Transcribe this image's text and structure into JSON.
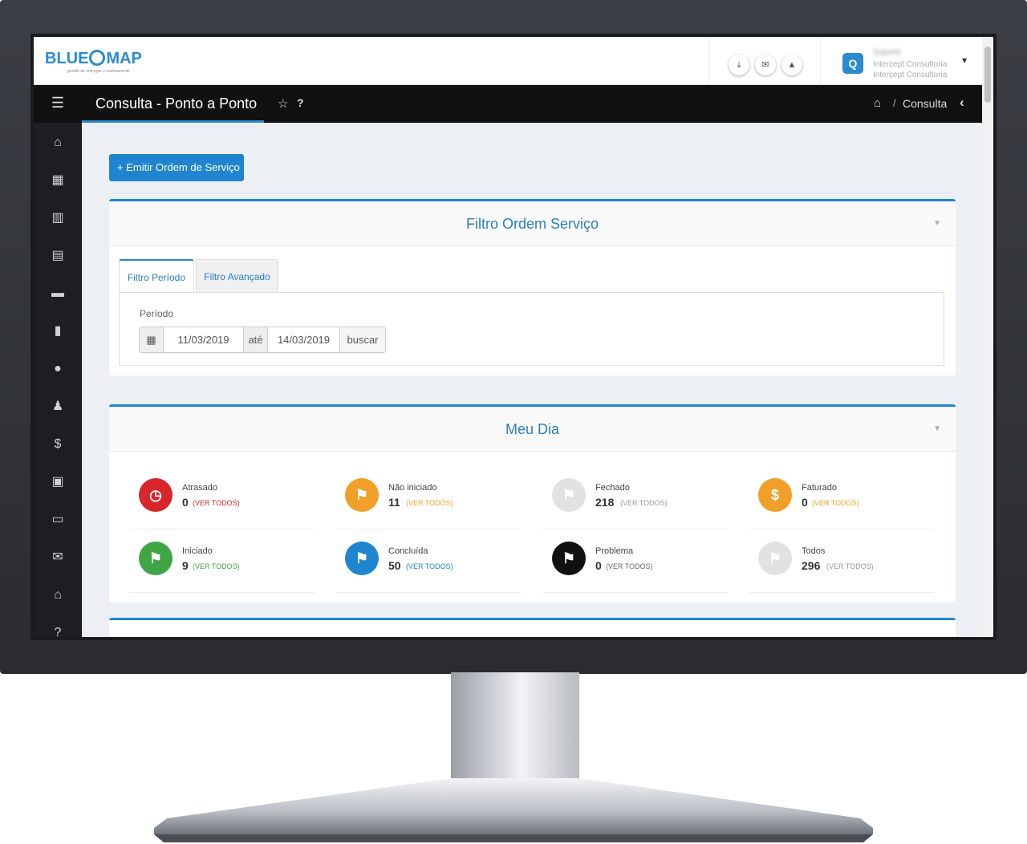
{
  "app": {
    "logo_left": "BLUE",
    "logo_right": "MAP",
    "logo_tagline": "gestão de entregas e rastreamento"
  },
  "topbar": {
    "icons": [
      "download-icon",
      "envelope-icon",
      "bell-icon"
    ],
    "user": {
      "name": "Suporte",
      "org_line1": "Intercept Consultoria",
      "org_line2": "Intercept Consultoria",
      "chevron": "⌄"
    }
  },
  "titlebar": {
    "menu_icon": "☰",
    "title": "Consulta - Ponto a Ponto",
    "star_icon": "☆",
    "help_icon": "?",
    "breadcrumb_sep": "/",
    "breadcrumb_label": "Consulta",
    "back_icon": "‹"
  },
  "sidebar": {
    "items": [
      "home-icon",
      "calendar-icon",
      "bar-chart-icon",
      "document-icon",
      "truck-icon",
      "file-icon",
      "map-marker-icon",
      "person-icon",
      "dollar-icon",
      "money-icon",
      "credit-card-icon",
      "envelope-icon",
      "bank-icon",
      "question-icon"
    ]
  },
  "main": {
    "emit_button": "+ Emitir Ordem de Serviço",
    "filter_panel": {
      "title": "Filtro Ordem Serviço",
      "tabs": [
        "Filtro Período",
        "Filtro Avançado"
      ],
      "periodo_label": "Período",
      "date_start": "11/03/2019",
      "date_sep": "até",
      "date_end": "14/03/2019",
      "search_button": "buscar"
    },
    "meu_dia_panel": {
      "title": "Meu Dia",
      "stats": [
        {
          "label": "Atrasado",
          "count": "0",
          "link": "(VER TODOS)",
          "color": "#d9262b",
          "link_color": "#d9262b"
        },
        {
          "label": "Não iniciado",
          "count": "11",
          "link": "(VER TODOS)",
          "color": "#f0a028",
          "link_color": "#f0a028"
        },
        {
          "label": "Fechado",
          "count": "218",
          "link": "(VER TODOS)",
          "color": "#e2e2e2",
          "link_color": "#999999"
        },
        {
          "label": "Faturado",
          "count": "0",
          "link": "(VER TODOS)",
          "color": "#f0a028",
          "link_color": "#f0a028"
        },
        {
          "label": "Iniciado",
          "count": "9",
          "link": "(VER TODOS)",
          "color": "#3ea645",
          "link_color": "#3ea645"
        },
        {
          "label": "Concluída",
          "count": "50",
          "link": "(VER TODOS)",
          "color": "#1f85d0",
          "link_color": "#1f85d0"
        },
        {
          "label": "Problema",
          "count": "0",
          "link": "(VER TODOS)",
          "color": "#111111",
          "link_color": "#666666"
        },
        {
          "label": "Todos",
          "count": "296",
          "link": "(VER TODOS)",
          "color": "#e2e2e2",
          "link_color": "#999999"
        }
      ]
    }
  }
}
